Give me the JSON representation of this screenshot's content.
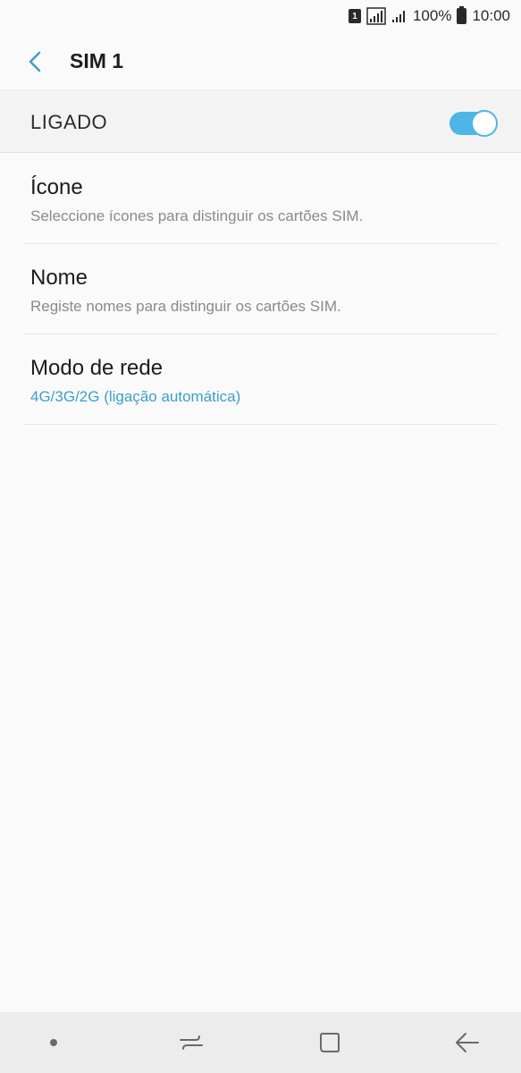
{
  "status_bar": {
    "sim_badge": "1",
    "battery_percent": "100%",
    "time": "10:00"
  },
  "header": {
    "title": "SIM 1",
    "back_icon": "chevron-left-icon"
  },
  "master_switch": {
    "label": "LIGADO",
    "on": true,
    "accent": "#4db6e6"
  },
  "settings": [
    {
      "title": "Ícone",
      "subtitle": "Seleccione ícones para distinguir os cartões SIM."
    },
    {
      "title": "Nome",
      "subtitle": "Registe nomes para distinguir os cartões SIM."
    },
    {
      "title": "Modo de rede",
      "subtitle": "4G/3G/2G (ligação automática)"
    }
  ],
  "nav_bar": {
    "icons": [
      "dot-icon",
      "recents-icon",
      "home-icon",
      "back-icon"
    ]
  },
  "colors": {
    "background": "#fafafa",
    "accent_text": "#3b9fc9",
    "secondary_text": "#8a8a8a"
  }
}
